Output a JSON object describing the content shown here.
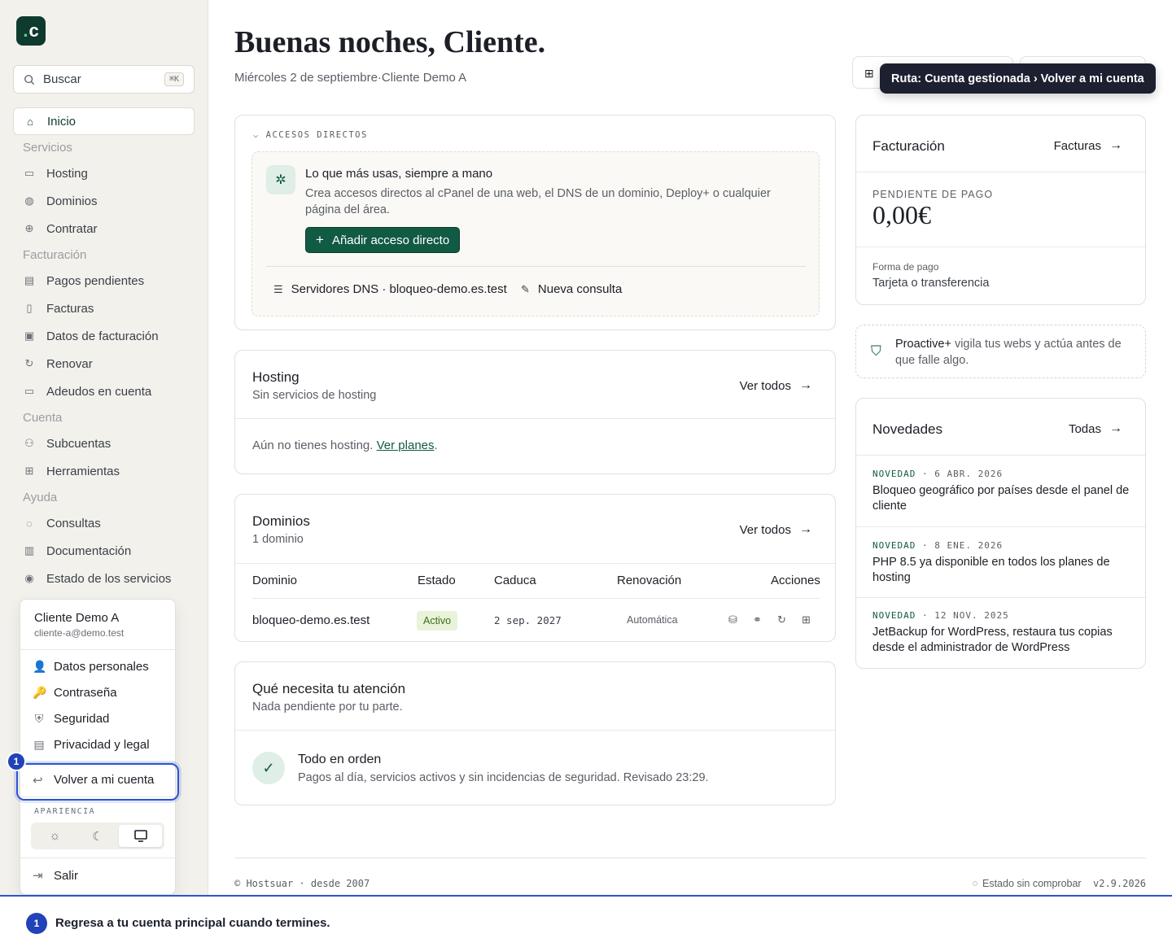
{
  "brand": {
    "logo_text": "c",
    "accent": "#0f3b2e"
  },
  "search": {
    "placeholder": "Buscar",
    "shortcut": "⌘K"
  },
  "sidebar": {
    "items": [
      {
        "label": "Inicio",
        "icon": "home-icon",
        "active": true
      },
      {
        "section": "Servicios"
      },
      {
        "label": "Hosting",
        "icon": "server-icon"
      },
      {
        "label": "Dominios",
        "icon": "globe-icon"
      },
      {
        "label": "Contratar",
        "icon": "plus-circle-icon"
      },
      {
        "section": "Facturación"
      },
      {
        "label": "Pagos pendientes",
        "icon": "wallet-icon"
      },
      {
        "label": "Facturas",
        "icon": "file-icon"
      },
      {
        "label": "Datos de facturación",
        "icon": "id-card-icon"
      },
      {
        "label": "Renovar",
        "icon": "refresh-icon"
      },
      {
        "label": "Adeudos en cuenta",
        "icon": "credit-card-icon"
      },
      {
        "section": "Cuenta"
      },
      {
        "label": "Subcuentas",
        "icon": "users-icon"
      },
      {
        "label": "Herramientas",
        "icon": "grid-icon"
      },
      {
        "section": "Ayuda"
      },
      {
        "label": "Consultas",
        "icon": "chat-icon"
      },
      {
        "label": "Documentación",
        "icon": "book-icon"
      },
      {
        "label": "Estado de los servicios",
        "icon": "signal-icon"
      }
    ]
  },
  "account_menu": {
    "name": "Cliente Demo A",
    "email": "cliente-a@demo.test",
    "items": [
      {
        "label": "Datos personales",
        "icon": "user-icon"
      },
      {
        "label": "Contraseña",
        "icon": "key-icon"
      },
      {
        "label": "Seguridad",
        "icon": "shield-icon"
      },
      {
        "label": "Privacidad y legal",
        "icon": "document-icon"
      }
    ],
    "volver": "Volver a mi cuenta",
    "appearance_label": "APARIENCIA",
    "theme_selected": "system",
    "salir": "Salir"
  },
  "header": {
    "greeting": "Buenas noches, Cliente.",
    "date": "Miércoles 2 de septiembre",
    "separator": "·",
    "account": "Cliente Demo A"
  },
  "tooltip": {
    "text": "Ruta: Cuenta gestionada › Volver a mi cuenta"
  },
  "shortcuts": {
    "label": "ACCESOS DIRECTOS",
    "title": "Lo que más usas, siempre a mano",
    "description": "Crea accesos directos al cPanel de una web, el DNS de un dominio, Deploy+ o cualquier página del área.",
    "add_button": "Añadir acceso directo",
    "links": [
      {
        "label": "Servidores DNS · bloqueo-demo.es.test",
        "icon": "dns-icon"
      },
      {
        "label": "Nueva consulta",
        "icon": "edit-icon"
      }
    ]
  },
  "hosting": {
    "title": "Hosting",
    "subtitle": "Sin servicios de hosting",
    "link": "Ver todos",
    "empty_text": "Aún no tienes hosting.",
    "empty_link": "Ver planes",
    "empty_after": "."
  },
  "domains": {
    "title": "Dominios",
    "subtitle": "1 dominio",
    "link": "Ver todos",
    "columns": [
      "Dominio",
      "Estado",
      "Caduca",
      "Renovación",
      "Acciones"
    ],
    "rows": [
      {
        "domain": "bloqueo-demo.es.test",
        "status": "Activo",
        "expires": "2 sep. 2027",
        "renewal": "Automática"
      }
    ]
  },
  "attention": {
    "title": "Qué necesita tu atención",
    "subtitle": "Nada pendiente por tu parte.",
    "ok_title": "Todo en orden",
    "ok_desc": "Pagos al día, servicios activos y sin incidencias de seguridad. Revisado 23:29."
  },
  "billing": {
    "title": "Facturación",
    "link": "Facturas",
    "pending_label": "PENDIENTE DE PAGO",
    "pending_amount": "0,00€",
    "method_label": "Forma de pago",
    "method": "Tarjeta o transferencia"
  },
  "proactive": {
    "bold": "Proactive+",
    "text": " vigila tus webs y actúa antes de que falle algo."
  },
  "news": {
    "title": "Novedades",
    "link": "Todas",
    "items": [
      {
        "tag": "NOVEDAD",
        "date": "6 ABR. 2026",
        "title": "Bloqueo geográfico por países desde el panel de cliente"
      },
      {
        "tag": "NOVEDAD",
        "date": "8 ENE. 2026",
        "title": "PHP 8.5 ya disponible en todos los planes de hosting"
      },
      {
        "tag": "NOVEDAD",
        "date": "12 NOV. 2025",
        "title": "JetBackup for WordPress, restaura tus copias desde el administrador de WordPress"
      }
    ]
  },
  "footer": {
    "copyright": "© Hostsuar · desde 2007",
    "status": "Estado sin comprobar",
    "version": "v2.9.2026"
  },
  "guide": {
    "step": "1",
    "text": "Regresa a tu cuenta principal cuando termines."
  }
}
